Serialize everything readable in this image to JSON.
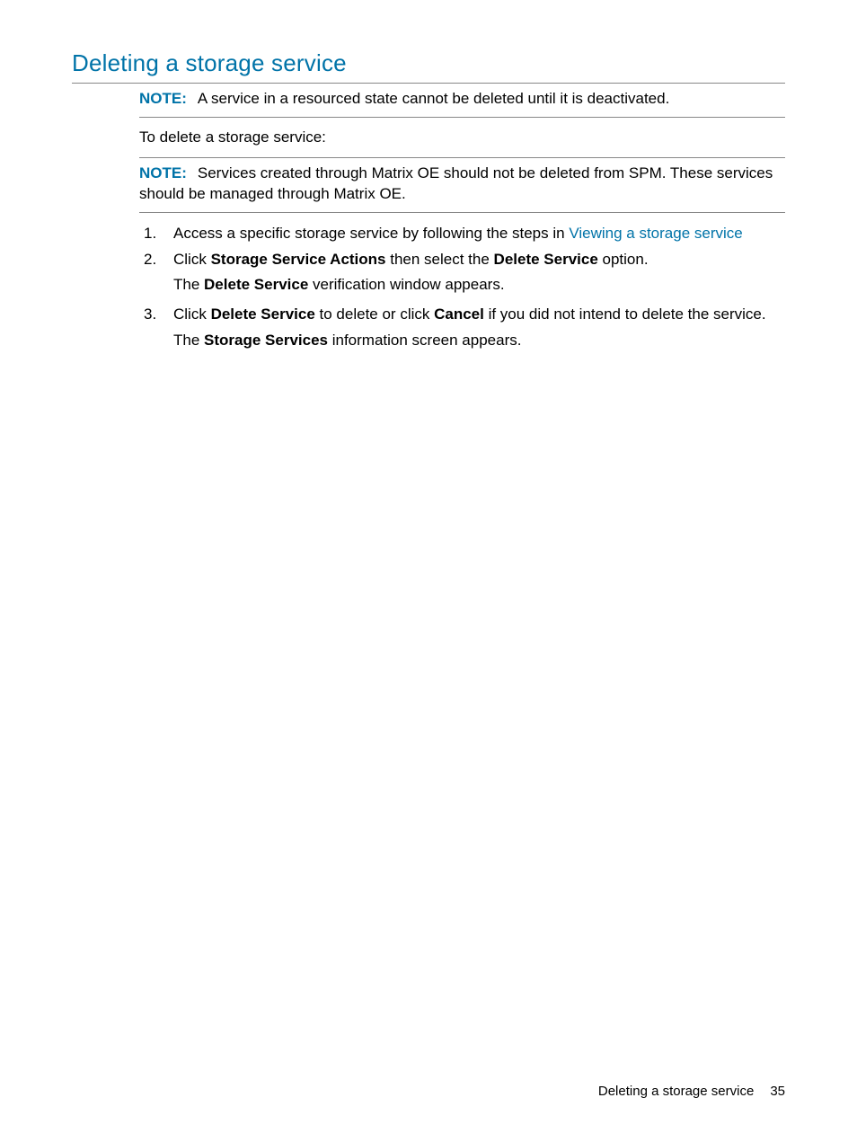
{
  "heading": "Deleting a storage service",
  "note1": {
    "label": "NOTE:",
    "text": "A service in a resourced state cannot be deleted until it is deactivated."
  },
  "intro": "To delete a storage service:",
  "note2": {
    "label": "NOTE:",
    "text": "Services created through Matrix OE should not be deleted from SPM. These services should be managed through Matrix OE."
  },
  "steps": {
    "s1": {
      "prefix": "Access a specific storage service by following the steps in ",
      "link": "Viewing a storage service"
    },
    "s2": {
      "t1": "Click ",
      "b1": "Storage Service Actions",
      "t2": " then select the ",
      "b2": "Delete Service",
      "t3": " option.",
      "f1": "The ",
      "fb1": "Delete Service",
      "f2": " verification window appears."
    },
    "s3": {
      "t1": "Click ",
      "b1": "Delete Service",
      "t2": " to delete or click ",
      "b2": "Cancel",
      "t3": " if you did not intend to delete the service.",
      "f1": "The ",
      "fb1": "Storage Services",
      "f2": " information screen appears."
    }
  },
  "footer": {
    "title": "Deleting a storage service",
    "page": "35"
  }
}
